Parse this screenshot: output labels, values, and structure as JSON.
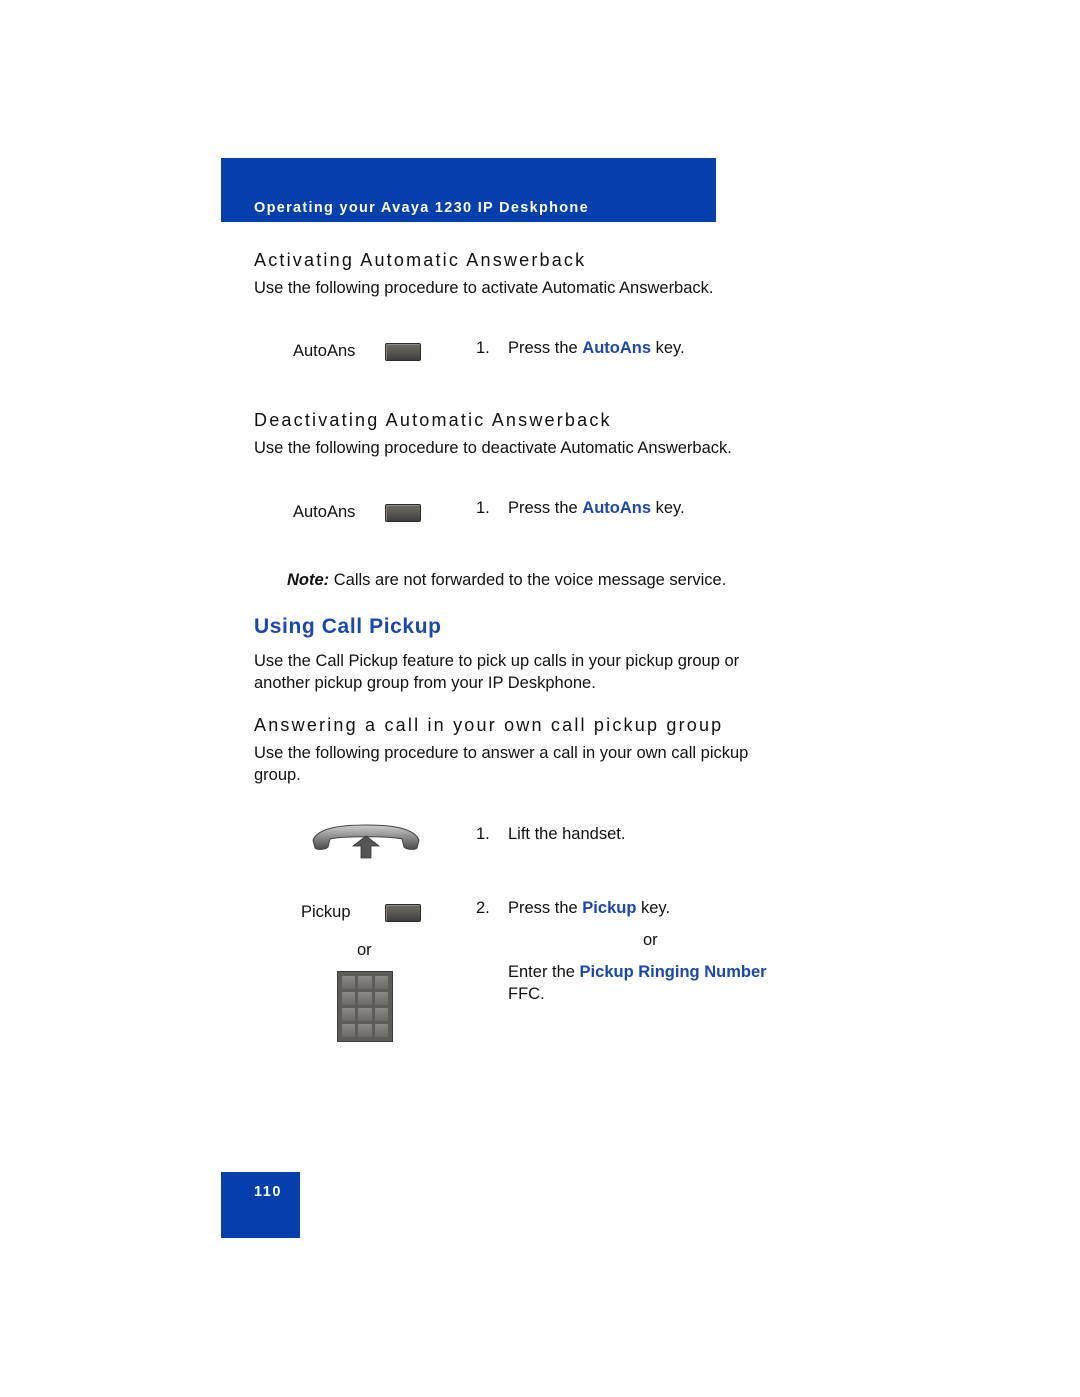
{
  "header": {
    "title": "Operating your Avaya 1230 IP Deskphone",
    "accent_color": "#0340ad"
  },
  "activate": {
    "heading": "Activating Automatic Answerback",
    "intro": "Use the following procedure to activate Automatic Answerback.",
    "key_label": "AutoAns",
    "step_number": "1.",
    "step_prefix": "Press the ",
    "step_key": "AutoAns",
    "step_suffix": " key."
  },
  "deactivate": {
    "heading": "Deactivating Automatic Answerback",
    "intro": "Use the following procedure to deactivate Automatic Answerback.",
    "key_label": "AutoAns",
    "step_number": "1.",
    "step_prefix": "Press the ",
    "step_key": "AutoAns",
    "step_suffix": " key."
  },
  "note": {
    "label": "Note:",
    "text": " Calls are not forwarded to the voice message service."
  },
  "call_pickup": {
    "title": "Using Call Pickup",
    "intro_line1": "Use the Call Pickup feature to pick up calls in your pickup group or",
    "intro_line2": "another pickup group from your IP Deskphone.",
    "subheading": "Answering a call in your own call pickup group",
    "sub_intro_line1": "Use the following procedure to answer a call in your own call pickup",
    "sub_intro_line2": "group.",
    "steps": [
      {
        "number": "1.",
        "text": "Lift the handset.",
        "icon": "handset-lift-icon"
      },
      {
        "number": "2.",
        "prefix": "Press the ",
        "key": "Pickup",
        "suffix": " key.",
        "key_label": "Pickup"
      }
    ],
    "or_left": "or",
    "or_right": "or",
    "alt_prefix": "Enter the ",
    "alt_key": "Pickup Ringing Number",
    "alt_suffix": "FFC."
  },
  "footer": {
    "page_number": "110"
  }
}
